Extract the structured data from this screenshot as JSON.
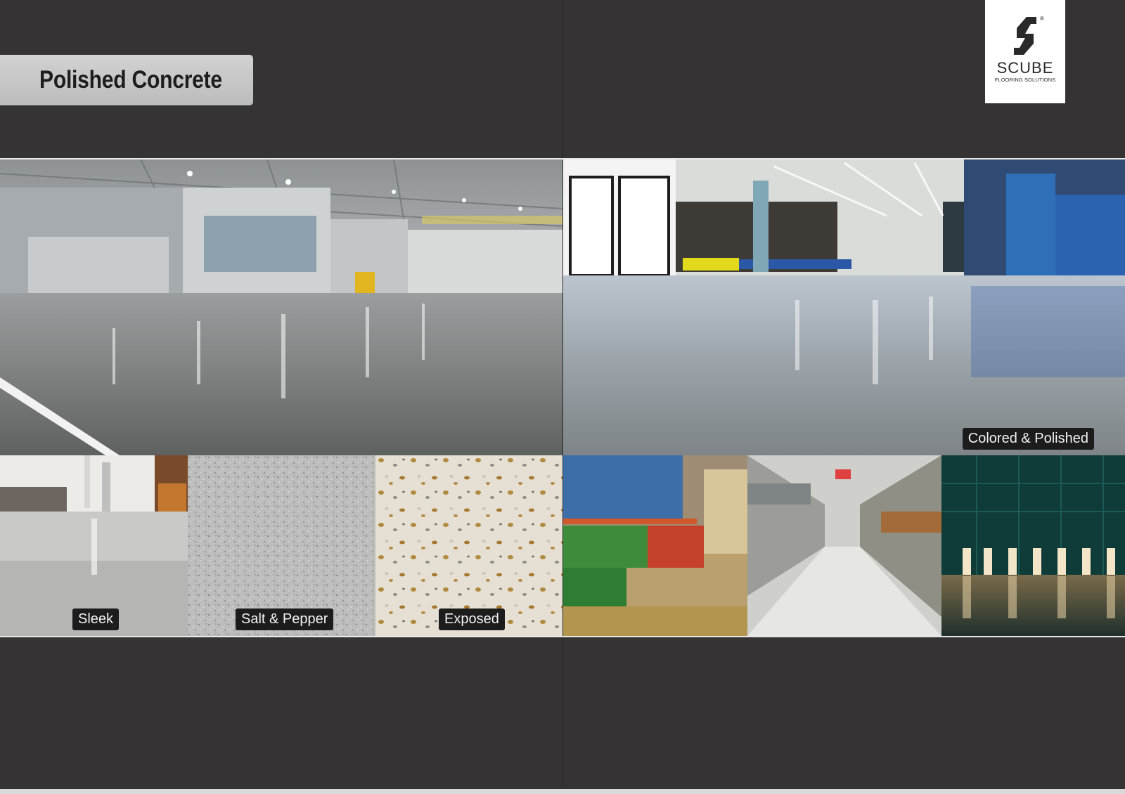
{
  "page": {
    "title": "Polished Concrete"
  },
  "logo": {
    "name": "SCUBE",
    "tagline": "FLOORING SOLUTIONS",
    "registered": "®",
    "icon": "scube-logo-icon"
  },
  "photos": [
    {
      "name": "factory-floor-photo",
      "caption": ""
    },
    {
      "name": "retail-store-floor-photo",
      "caption": "Colored & Polished"
    },
    {
      "name": "sleek-finish-photo",
      "caption": "Sleek"
    },
    {
      "name": "salt-pepper-finish-photo",
      "caption": "Salt & Pepper"
    },
    {
      "name": "exposed-finish-photo",
      "caption": "Exposed"
    },
    {
      "name": "warehouse-racks-photo",
      "caption": ""
    },
    {
      "name": "supermarket-aisle-photo",
      "caption": ""
    },
    {
      "name": "hangar-floor-photo",
      "caption": ""
    }
  ],
  "colors": {
    "background": "#353334",
    "banner": "#c9c9c9",
    "caption_bg": "#1c1c1c"
  }
}
